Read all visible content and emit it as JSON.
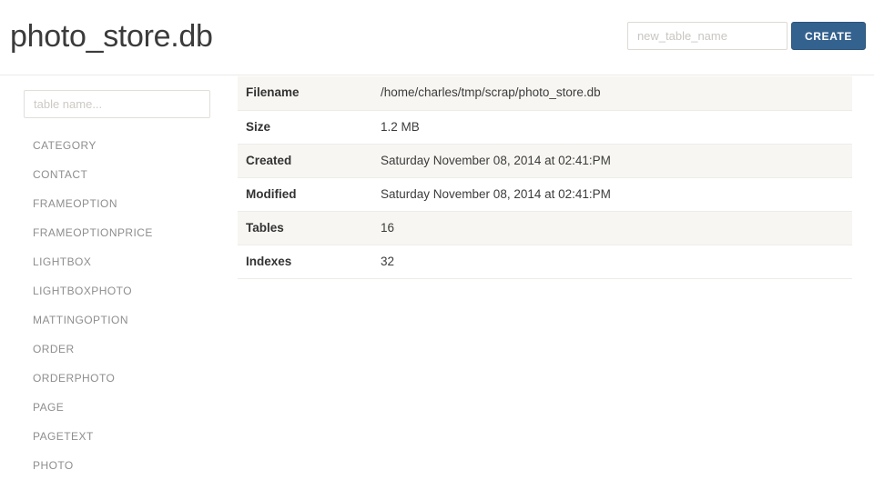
{
  "header": {
    "title": "photo_store.db",
    "new_table_placeholder": "new_table_name",
    "new_table_value": "",
    "create_label": "CREATE"
  },
  "sidebar": {
    "filter_placeholder": "table name...",
    "filter_value": "",
    "tables": [
      {
        "name": "CATEGORY"
      },
      {
        "name": "CONTACT"
      },
      {
        "name": "FRAMEOPTION"
      },
      {
        "name": "FRAMEOPTIONPRICE"
      },
      {
        "name": "LIGHTBOX"
      },
      {
        "name": "LIGHTBOXPHOTO"
      },
      {
        "name": "MATTINGOPTION"
      },
      {
        "name": "ORDER"
      },
      {
        "name": "ORDERPHOTO"
      },
      {
        "name": "PAGE"
      },
      {
        "name": "PAGETEXT"
      },
      {
        "name": "PHOTO"
      }
    ]
  },
  "info": {
    "rows": [
      {
        "key": "Filename",
        "value": "/home/charles/tmp/scrap/photo_store.db"
      },
      {
        "key": "Size",
        "value": "1.2 MB"
      },
      {
        "key": "Created",
        "value": "Saturday November 08, 2014 at 02:41:PM"
      },
      {
        "key": "Modified",
        "value": "Saturday November 08, 2014 at 02:41:PM"
      },
      {
        "key": "Tables",
        "value": "16"
      },
      {
        "key": "Indexes",
        "value": "32"
      }
    ]
  },
  "colors": {
    "accent": "#34628f",
    "stripe": "#f7f6f2",
    "border": "#eeece7",
    "title": "#3b3b3b",
    "muted": "#8e8e8e"
  }
}
